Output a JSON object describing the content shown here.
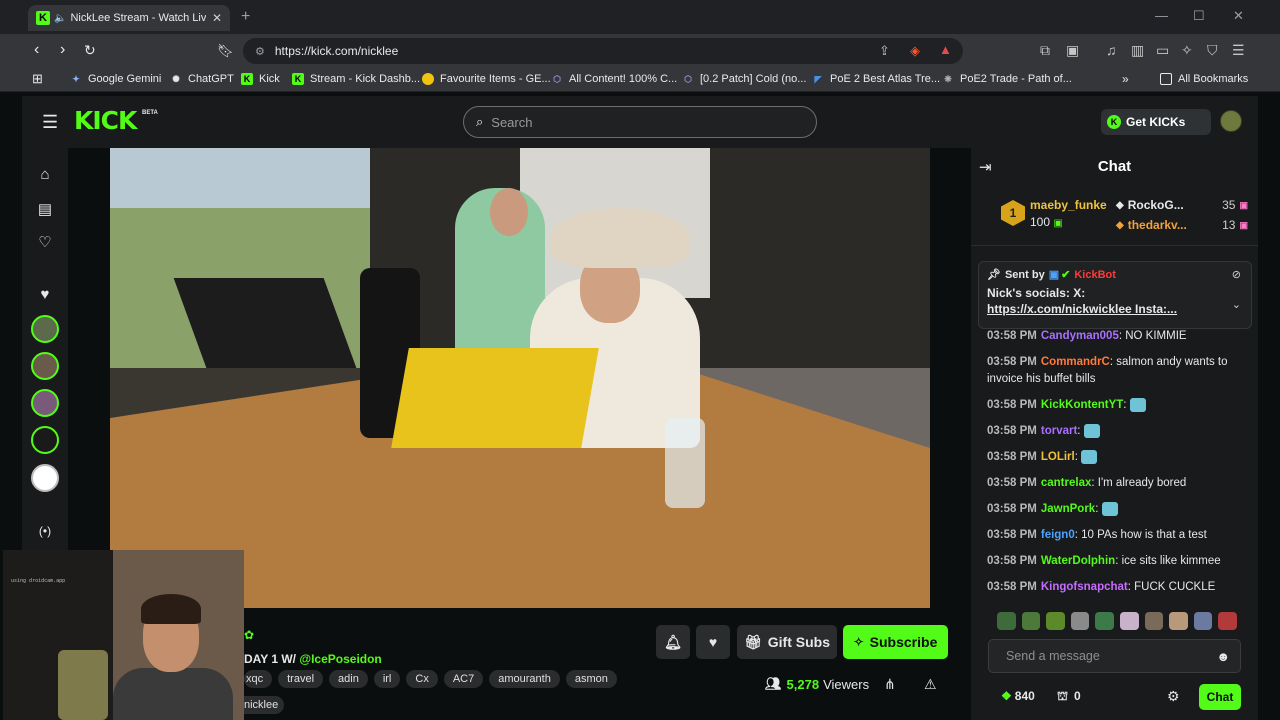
{
  "browser": {
    "tab": {
      "title": "NickLee Stream - Watch Live"
    },
    "url": "https://kick.com/nicklee",
    "bookmarks": [
      {
        "label": "Google Gemini",
        "icon": "gemini-icon",
        "color": "#8ab4f8"
      },
      {
        "label": "ChatGPT",
        "icon": "chatgpt-icon",
        "color": "#e8eaed"
      },
      {
        "label": "Kick",
        "icon": "kick-icon",
        "color": "#53fc18"
      },
      {
        "label": "Stream - Kick Dashb...",
        "icon": "kick-icon",
        "color": "#53fc18"
      },
      {
        "label": "Favourite Items - GE...",
        "icon": "ge-icon",
        "color": "#f1c40f"
      },
      {
        "label": "All Content! 100% C...",
        "icon": "poe-icon",
        "color": "#9b8bd6"
      },
      {
        "label": "[0.2 Patch] Cold (no...",
        "icon": "poe-icon",
        "color": "#9b8bd6"
      },
      {
        "label": "PoE 2 Best Atlas Tre...",
        "icon": "poe2-icon",
        "color": "#4a90e2"
      },
      {
        "label": "PoE2 Trade - Path of...",
        "icon": "poe-trade-icon",
        "color": "#b0b0b0"
      }
    ],
    "all_bookmarks": "All Bookmarks"
  },
  "kick": {
    "logo": "KICK",
    "beta": "BETA",
    "search_placeholder": "Search",
    "get_kicks": "Get KICKs"
  },
  "stream": {
    "title_prefix": "DAY 1 W/",
    "title_handle": "@IcePoseidon",
    "tags": [
      "xqc",
      "travel",
      "adin",
      "irl",
      "Cx",
      "AC7",
      "amouranth",
      "asmon"
    ],
    "channel": "nicklee",
    "viewers": "5,278",
    "viewers_label": "Viewers",
    "gift_subs": "Gift Subs",
    "subscribe": "Subscribe",
    "facecam_text": "using droidcam.app"
  },
  "chat": {
    "title": "Chat",
    "leaderboard": {
      "top": {
        "rank": "1",
        "name": "maeby_funke",
        "amount": "100"
      },
      "others": [
        {
          "name": "RockoG...",
          "amount": "35",
          "color": "#e8e8e8",
          "gem_color": "#e8e8e8"
        },
        {
          "name": "thedarkv...",
          "amount": "13",
          "color": "#f0a23c",
          "gem_color": "#f0a23c"
        }
      ]
    },
    "pinned": {
      "sent_by": "Sent by",
      "bot": "KickBot",
      "line1": "Nick's socials: X:",
      "link": "https://x.com/nickwicklee Insta:..."
    },
    "messages": [
      {
        "time": "03:58 PM",
        "user": "Candyman005",
        "color": "#a970ff",
        "text": "NO KIMMIE"
      },
      {
        "time": "03:58 PM",
        "user": "CommandrC",
        "color": "#ff7a3c",
        "text": "salmon andy wants to invoice his buffet bills"
      },
      {
        "time": "03:58 PM",
        "user": "KickKontentYT",
        "color": "#53fc18",
        "text": ""
      },
      {
        "time": "03:58 PM",
        "user": "torvart",
        "color": "#a970ff",
        "text": ""
      },
      {
        "time": "03:58 PM",
        "user": "LOLirl",
        "color": "#f0c23c",
        "text": ""
      },
      {
        "time": "03:58 PM",
        "user": "cantrelax",
        "color": "#53fc18",
        "text": "I'm already bored"
      },
      {
        "time": "03:58 PM",
        "user": "JawnPork",
        "color": "#53fc18",
        "text": ""
      },
      {
        "time": "03:58 PM",
        "user": "feign0",
        "color": "#4aa3ff",
        "text": "10 PAs how is that a test"
      },
      {
        "time": "03:58 PM",
        "user": "WaterDolphin",
        "color": "#53fc18",
        "text": "ice sits like kimmee"
      },
      {
        "time": "03:58 PM",
        "user": "Kingofsnapchat",
        "color": "#c76cff",
        "text": "FUCK CUCKLE"
      }
    ],
    "input_placeholder": "Send a message",
    "points": "840",
    "count": "0",
    "chat_button": "Chat"
  },
  "colors": {
    "accent": "#53fc18",
    "bg": "#0b0e0f",
    "panel": "#181a1b"
  }
}
